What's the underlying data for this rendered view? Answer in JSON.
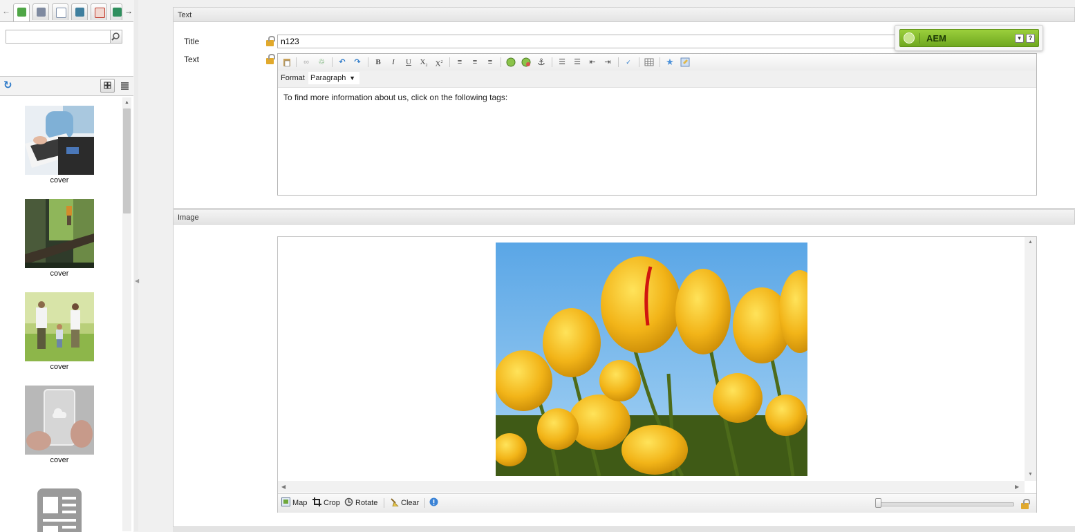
{
  "finder": {
    "search": {
      "value": "",
      "placeholder": ""
    },
    "assets": [
      {
        "caption": "cover",
        "image": "laptop-desk-photo"
      },
      {
        "caption": "cover",
        "image": "forest-hiker-photo"
      },
      {
        "caption": "cover",
        "image": "family-walking-photo"
      },
      {
        "caption": "cover",
        "image": "transparent-phone-photo"
      },
      {
        "caption": "",
        "image": "page-template-icon"
      }
    ]
  },
  "text_panel": {
    "header": "Text",
    "title_label": "Title",
    "title_value": "n123",
    "text_label": "Text",
    "format_label": "Format",
    "format_value": "Paragraph",
    "content": "To find more information about us, click on the following tags:"
  },
  "image_panel": {
    "header": "Image",
    "image_alt": "yellow-tulips-photo",
    "toolbar": {
      "map": "Map",
      "crop": "Crop",
      "rotate": "Rotate",
      "clear": "Clear"
    },
    "zoom_level": 0
  },
  "sidekick": {
    "title": "AEM"
  },
  "colors": {
    "sidekick_green": "#8cc63f",
    "lock_gold": "#e1a92c",
    "accent_blue": "#2a78c8"
  }
}
